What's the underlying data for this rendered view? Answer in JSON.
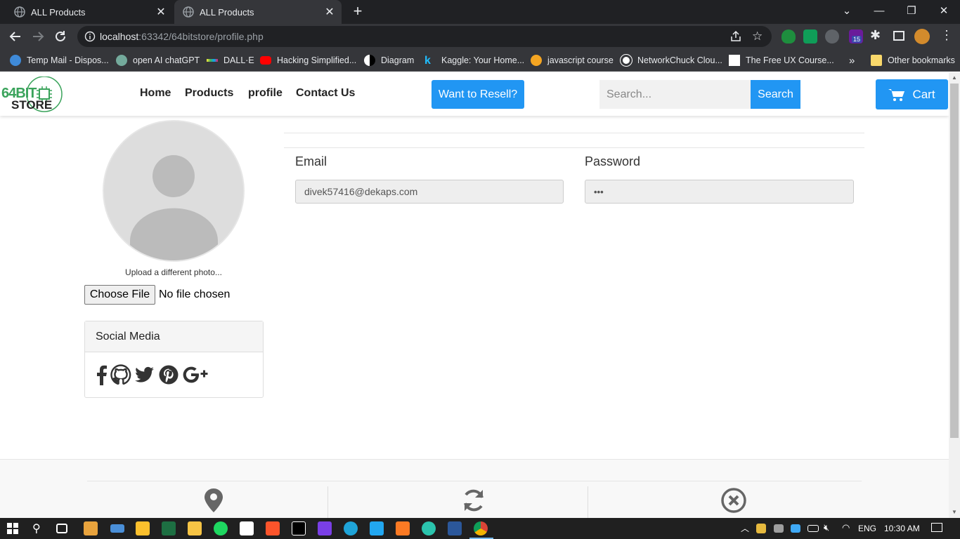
{
  "browser": {
    "tabs": [
      {
        "title": "ALL Products"
      },
      {
        "title": "ALL Products"
      }
    ],
    "new_tab": "+",
    "url_host": "localhost",
    "url_rest": ":63342/64bitstore/profile.php",
    "bookmarks": [
      {
        "label": "Temp Mail - Dispos..."
      },
      {
        "label": "open AI chatGPT"
      },
      {
        "label": "DALL·E"
      },
      {
        "label": "Hacking Simplified..."
      },
      {
        "label": "Diagram"
      },
      {
        "label": "Kaggle: Your Home..."
      },
      {
        "label": "javascript course"
      },
      {
        "label": "NetworkChuck Clou..."
      },
      {
        "label": "The Free UX Course..."
      }
    ],
    "more_bookmarks": "»",
    "other_bookmarks": "Other bookmarks",
    "extension_badge": "15"
  },
  "site": {
    "logo_top": "64BIT",
    "logo_bottom": "STORE",
    "nav": [
      "Home",
      "Products",
      "profile",
      "Contact Us"
    ],
    "resell_label": "Want to Resell?",
    "search_placeholder": "Search...",
    "search_label": "Search",
    "cart_label": "Cart"
  },
  "profile": {
    "upload_text": "Upload a different photo...",
    "choose_file": "Choose File",
    "no_file": "No file chosen",
    "social_title": "Social Media",
    "social_icons": [
      "facebook-icon",
      "github-icon",
      "twitter-icon",
      "pinterest-icon",
      "google-plus-icon"
    ],
    "email_label": "Email",
    "email_value": "divek57416@dekaps.com",
    "password_label": "Password",
    "password_value": "•••"
  },
  "footer": {
    "icons": [
      "map-marker-icon",
      "refresh-icon",
      "close-circle-icon"
    ]
  },
  "taskbar": {
    "lang": "ENG",
    "time": "10:30 AM"
  },
  "colors": {
    "accent": "#2196f3",
    "chrome_dark": "#202124",
    "chrome_mid": "#35363a"
  }
}
